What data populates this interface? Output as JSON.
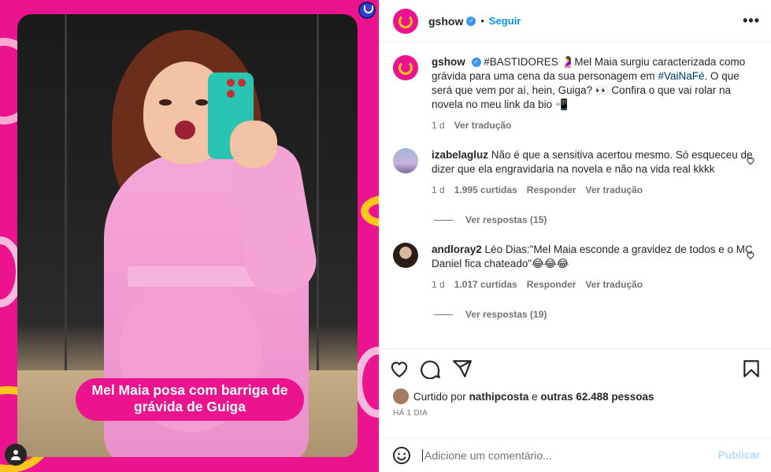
{
  "post": {
    "image_caption": "Mel Maia posa com barriga de grávida de Guiga"
  },
  "header": {
    "username": "gshow",
    "separator": "•",
    "follow_label": "Seguir",
    "more_label": "•••"
  },
  "caption": {
    "username": "gshow",
    "text_part1": "#BASTIDORES 🤰Mel Maia surgiu caracterizada como grávida para uma cena da sua personagem em ",
    "hashtag": "#VaiNaFé",
    "text_part2": ". O que será que vem por aí, hein, Guiga? 👀 Confira o que vai rolar na novela no meu link da bio 📲",
    "time": "1 d",
    "translate": "Ver tradução"
  },
  "comments": [
    {
      "username": "izabelagluz",
      "text": "Não é que a sensitiva acertou mesmo. Só esqueceu de dizer que ela engravidaria na novela e não na vida real kkkk",
      "time": "1 d",
      "likes": "1.995 curtidas",
      "reply": "Responder",
      "translate": "Ver tradução",
      "view_replies": "Ver respostas (15)"
    },
    {
      "username": "andloray2",
      "text": "Léo Dias:\"Mel Maia esconde a gravidez de todos e o MC Daniel fica chateado\"😂😂😂",
      "time": "1 d",
      "likes": "1.017 curtidas",
      "reply": "Responder",
      "translate": "Ver tradução",
      "view_replies": "Ver respostas (19)"
    }
  ],
  "likes": {
    "prefix": "Curtido por",
    "user": "nathipcosta",
    "middle": "e",
    "others": "outras 62.488 pessoas"
  },
  "posted_ago": "HÁ 1 DIA",
  "add_comment": {
    "placeholder": "Adicione um comentário...",
    "publish_label": "Publicar"
  },
  "colors": {
    "brand_pink": "#ec138f",
    "brand_yellow": "#ffc61b",
    "link_blue": "#0095f6"
  },
  "icons": [
    "heart-icon",
    "comment-icon",
    "share-icon",
    "bookmark-icon",
    "emoji-icon",
    "verified-icon",
    "user-tag-icon"
  ]
}
